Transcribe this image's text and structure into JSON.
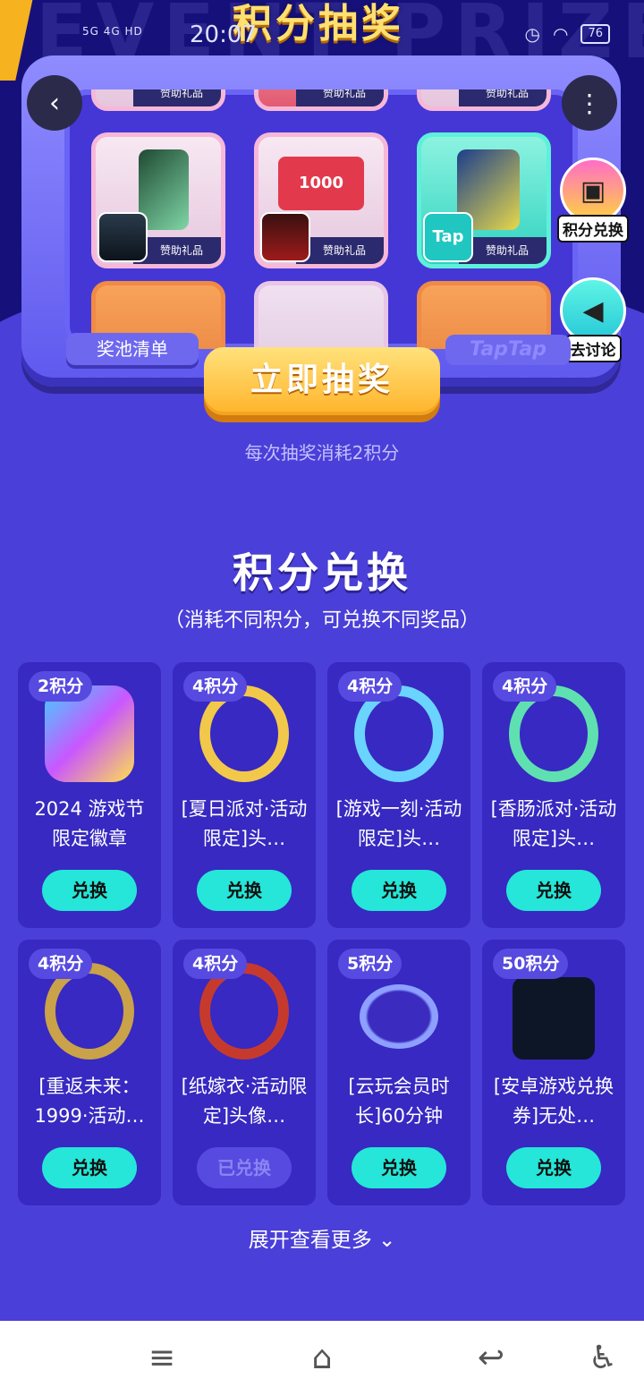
{
  "header": {
    "bg_text": "EVENT PRIZES",
    "lottery_title": "积分抽奖"
  },
  "status_bar": {
    "signal": "5G 4G HD",
    "time": "20:07",
    "battery": "76"
  },
  "lottery": {
    "prize_tag": "赞助礼品",
    "prize_value_label": "1000",
    "tap_logo": "Tap",
    "pool_button": "奖池清单",
    "brand_tag": "TapTap",
    "draw_button": "立即抽奖",
    "cost_note": "每次抽奖消耗2积分"
  },
  "side_actions": {
    "exchange_label": "积分兑换",
    "discuss_label": "去讨论"
  },
  "exchange": {
    "title": "积分兑换",
    "subtitle": "（消耗不同积分，可兑换不同奖品）",
    "items": [
      {
        "points": "2积分",
        "name": "2024 游戏节限定徽章",
        "button": "兑换"
      },
      {
        "points": "4积分",
        "name": "[夏日派对·活动限定]头…",
        "button": "兑换"
      },
      {
        "points": "4积分",
        "name": "[游戏一刻·活动限定]头…",
        "button": "兑换"
      },
      {
        "points": "4积分",
        "name": "[香肠派对·活动限定]头…",
        "button": "兑换"
      },
      {
        "points": "4积分",
        "name": "[重返未来：1999·活动…",
        "button": "兑换"
      },
      {
        "points": "4积分",
        "name": "[纸嫁衣·活动限定]头像…",
        "button": "已兑换"
      },
      {
        "points": "5积分",
        "name": "[云玩会员时长]60分钟",
        "button": "兑换"
      },
      {
        "points": "50积分",
        "name": "[安卓游戏兑换券]无处…",
        "button": "兑换"
      }
    ],
    "expand_label": "展开查看更多"
  },
  "colors": {
    "accent": "#25e6d8",
    "bg": "#4a3fd8",
    "gold": "#ffb32a"
  }
}
